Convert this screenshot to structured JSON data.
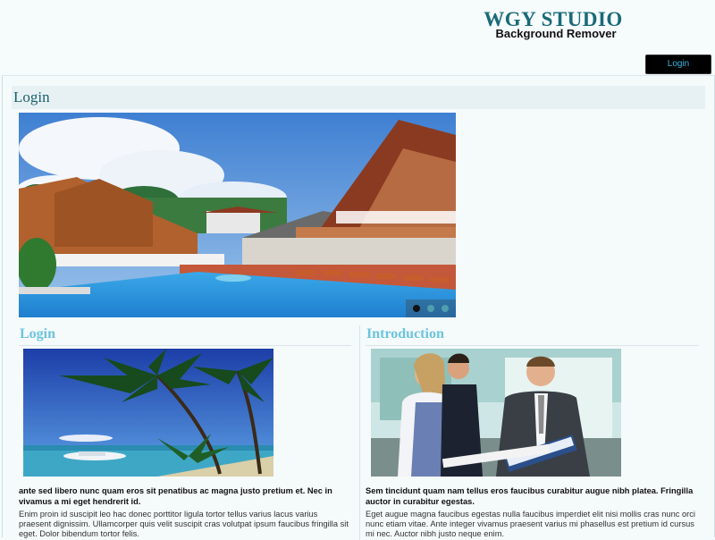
{
  "brand": {
    "title": "WGY STUDIO",
    "subtitle": "Background Remover"
  },
  "header": {
    "login_button": "Login"
  },
  "page": {
    "title": "Login"
  },
  "slider": {
    "slide_count": 3,
    "active_slide": 1
  },
  "columns": [
    {
      "title": "Login",
      "lead": "ante sed libero nunc quam eros sit penatibus ac magna justo pretium et. Nec in vivamus a mi eget hendrerit id.",
      "body": "Enim proin id suscipit leo hac donec porttitor ligula tortor tellus varius lacus varius praesent dignissim. Ullamcorper quis velit suscipit cras volutpat ipsum faucibus fringilla sit eget. Dolor bibendum tortor felis."
    },
    {
      "title": "Introduction",
      "lead": "Sem tincidunt quam nam tellus eros faucibus curabitur augue nibh platea. Fringilla auctor in curabitur egestas.",
      "body": "Eget augue magna faucibus egestas nulla faucibus imperdiet elit nisi mollis cras nunc orci nunc etiam vitae. Ante integer vivamus praesent varius mi phasellus est pretium id cursus mi nec. Auctor nibh justo neque enim."
    }
  ],
  "colors": {
    "brand": "#1b6a78",
    "accent": "#6cc4df",
    "button_bg": "#000000",
    "button_text": "#36b6e6"
  }
}
